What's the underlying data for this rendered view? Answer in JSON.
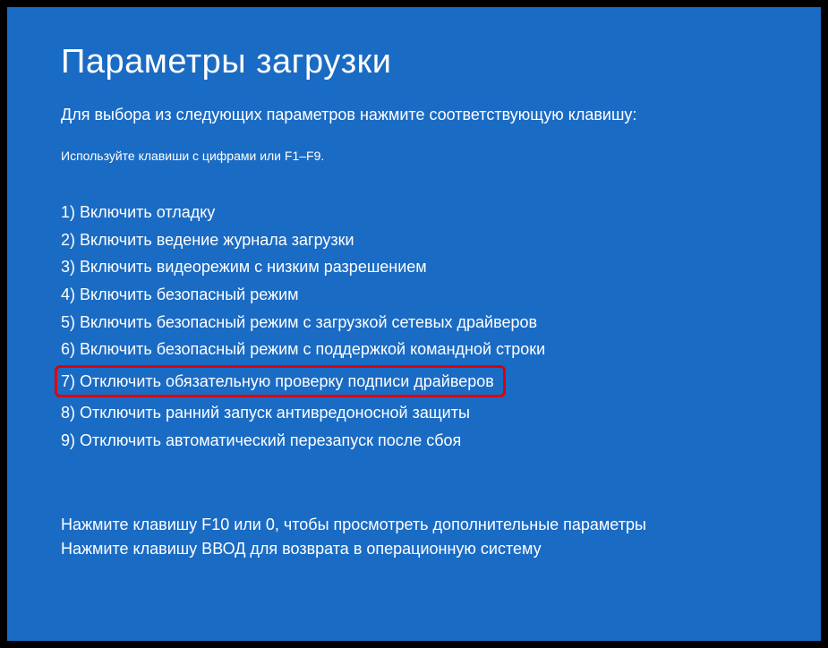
{
  "title": "Параметры загрузки",
  "instruction": "Для выбора из следующих параметров нажмите соответствующую клавишу:",
  "subinstruction": "Используйте клавиши с цифрами или F1–F9.",
  "options": [
    "1) Включить отладку",
    "2) Включить ведение журнала загрузки",
    "3) Включить видеорежим с низким разрешением",
    "4) Включить безопасный режим",
    "5) Включить безопасный режим с загрузкой сетевых драйверов",
    "6) Включить безопасный режим с поддержкой командной строки",
    "7) Отключить обязательную проверку подписи драйверов",
    "8) Отключить ранний запуск антивредоносной защиты",
    "9) Отключить автоматический перезапуск после сбоя"
  ],
  "highlighted_index": 6,
  "footer": {
    "line1": "Нажмите клавишу F10 или 0, чтобы просмотреть дополнительные параметры",
    "line2": "Нажмите клавишу ВВОД для возврата в операционную систему"
  }
}
